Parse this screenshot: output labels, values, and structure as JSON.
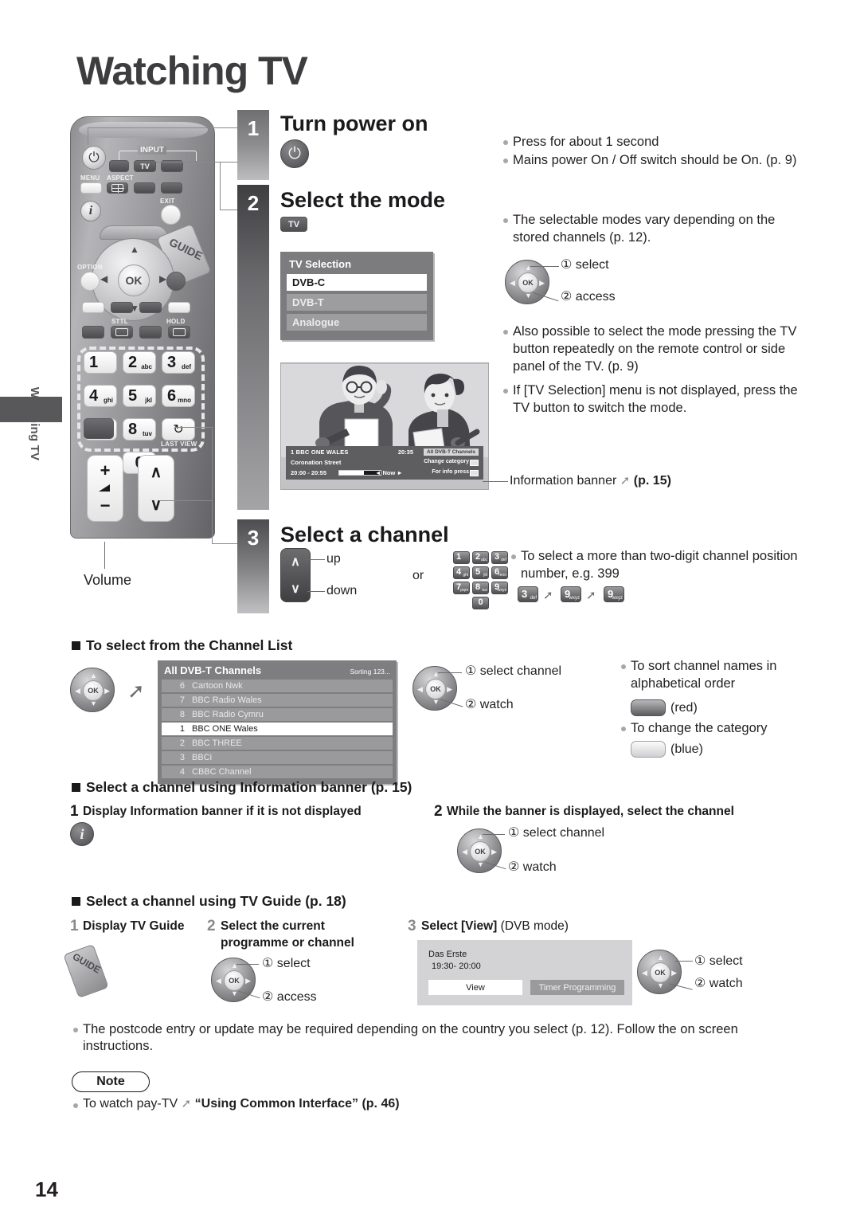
{
  "page": {
    "title": "Watching TV",
    "side_tab_label": "Watching TV",
    "number": "14"
  },
  "remote": {
    "labels": {
      "input": "INPUT",
      "tv": "TV",
      "menu": "MENU",
      "aspect": "ASPECT",
      "exit": "EXIT",
      "option": "OPTION",
      "guide": "GUIDE",
      "sttl": "STTL",
      "hold": "HOLD",
      "last_view": "LAST VIEW",
      "ok": "OK",
      "volume_caption": "Volume",
      "power_glyph": "⏻",
      "info_glyph": "i",
      "plus": "+",
      "minus": "−",
      "chan_up": "∧",
      "chan_down": "∨",
      "last_view_glyph": "↻"
    },
    "keypad": [
      {
        "digit": "1",
        "sub": ""
      },
      {
        "digit": "2",
        "sub": "abc"
      },
      {
        "digit": "3",
        "sub": "def"
      },
      {
        "digit": "4",
        "sub": "ghi"
      },
      {
        "digit": "5",
        "sub": "jkl"
      },
      {
        "digit": "6",
        "sub": "mno"
      },
      {
        "digit": "7",
        "sub": "pqrs"
      },
      {
        "digit": "8",
        "sub": "tuv"
      },
      {
        "digit": "9",
        "sub": "wxyz"
      },
      {
        "digit": "0",
        "sub": ""
      }
    ]
  },
  "steps": [
    {
      "num": "1",
      "title": "Turn power on",
      "bullets": [
        "Press for about 1 second",
        "Mains power On / Off switch should be On. (p. 9)"
      ]
    },
    {
      "num": "2",
      "title": "Select the mode",
      "chip": "TV",
      "bullets_a": [
        "The selectable modes vary depending on the stored channels (p. 12)."
      ],
      "dial": {
        "select": "① select",
        "access": "② access"
      },
      "bullets_b": [
        "Also possible to select the mode pressing the TV button repeatedly on the remote control or side panel of the TV. (p. 9)",
        "If [TV Selection] menu is not displayed, press the TV button to switch the mode."
      ]
    },
    {
      "num": "3",
      "title": "Select a channel",
      "up_label": "up",
      "down_label": "down",
      "or_label": "or",
      "bullet": "To select a more than two-digit channel position number, e.g. 399",
      "example_keys": [
        {
          "digit": "3",
          "sub": "def"
        },
        {
          "digit": "9",
          "sub": "wxyz"
        },
        {
          "digit": "9",
          "sub": "wxyz"
        }
      ]
    }
  ],
  "tv_selection": {
    "title": "TV Selection",
    "options": [
      {
        "label": "DVB-C",
        "selected": true
      },
      {
        "label": "DVB-T",
        "selected": false
      },
      {
        "label": "Analogue",
        "selected": false
      }
    ]
  },
  "information_banner": {
    "caption_text": "Information banner",
    "caption_page": "(p. 15)",
    "channel": "1 BBC ONE WALES",
    "clock": "20:35",
    "category_chip": "All DVB-T Channels",
    "programme": "Coronation Street",
    "time_range": "20:00 - 20:55",
    "now": "◄ Now ►",
    "change_category": "Change category",
    "for_info_press": "For info press"
  },
  "channel_list_section": {
    "heading": "To select from the Channel List",
    "osd": {
      "title": "All DVB-T Channels",
      "sorting": "Sorting 123...",
      "rows": [
        {
          "num": "6",
          "name": "Cartoon Nwk",
          "selected": false
        },
        {
          "num": "7",
          "name": "BBC Radio Wales",
          "selected": false
        },
        {
          "num": "8",
          "name": "BBC Radio Cymru",
          "selected": false
        },
        {
          "num": "1",
          "name": "BBC ONE Wales",
          "selected": true
        },
        {
          "num": "2",
          "name": "BBC THREE",
          "selected": false
        },
        {
          "num": "3",
          "name": "BBCi",
          "selected": false
        },
        {
          "num": "4",
          "name": "CBBC Channel",
          "selected": false
        }
      ]
    },
    "dial": {
      "select": "① select channel",
      "watch": "② watch"
    },
    "tips": [
      {
        "text": "To sort channel names in alphabetical order",
        "button_color": "red",
        "button_label": "(red)"
      },
      {
        "text": "To change the category",
        "button_color": "blue",
        "button_label": "(blue)"
      }
    ]
  },
  "info_banner_section": {
    "heading": "Select a channel using Information banner (p. 15)",
    "step1": {
      "num": "1",
      "title": "Display Information banner if it is not displayed"
    },
    "step2": {
      "num": "2",
      "title": "While the banner is displayed, select the channel",
      "dial": {
        "select": "① select channel",
        "watch": "② watch"
      }
    }
  },
  "tv_guide_section": {
    "heading": "Select a channel using TV Guide (p. 18)",
    "step1": {
      "num": "1",
      "title": "Display TV Guide",
      "key_label": "GUIDE"
    },
    "step2": {
      "num": "2",
      "title_line1": "Select the current",
      "title_line2": "programme or channel",
      "dial": {
        "select": "① select",
        "access": "② access"
      }
    },
    "step3": {
      "num": "3",
      "title_bold": "Select [View]",
      "title_plain": "(DVB mode)",
      "osd": {
        "channel": "Das Erste",
        "time": "19:30- 20:00",
        "view_button": "View",
        "timer_button": "Timer Programming"
      },
      "dial": {
        "select": "① select",
        "watch": "② watch"
      }
    }
  },
  "footer": {
    "postcode_note": "The postcode entry or update may be required depending on the country you select (p. 12). Follow the on screen instructions.",
    "note_label": "Note",
    "note_prefix": "To watch pay-TV",
    "note_bold": "“Using Common Interface” (p. 46)"
  },
  "colors": {
    "heading": "#1a1a1c",
    "step_bar_dark": "#3f3f42",
    "osd_bg": "#7c7c7f",
    "selected_row": "#ffffff"
  }
}
